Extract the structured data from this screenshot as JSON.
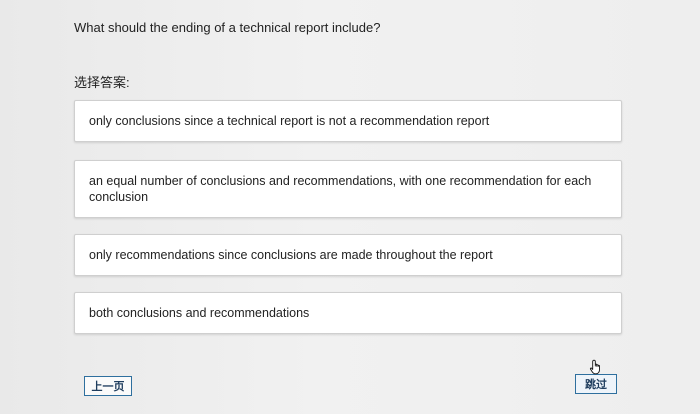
{
  "question": {
    "text": "What should the ending of a technical report include?"
  },
  "answers_label": "选择答案:",
  "options": [
    {
      "label": "only conclusions since a technical report is not a recommendation report"
    },
    {
      "label": "an equal number of conclusions and recommendations, with one recommendation for each conclusion"
    },
    {
      "label": "only recommendations since conclusions are made throughout the report"
    },
    {
      "label": "both conclusions and recommendations"
    }
  ],
  "navigation": {
    "prev_label": "上一页",
    "skip_label": "跳过"
  },
  "icons": {
    "cursor": "hand-pointer-icon"
  }
}
